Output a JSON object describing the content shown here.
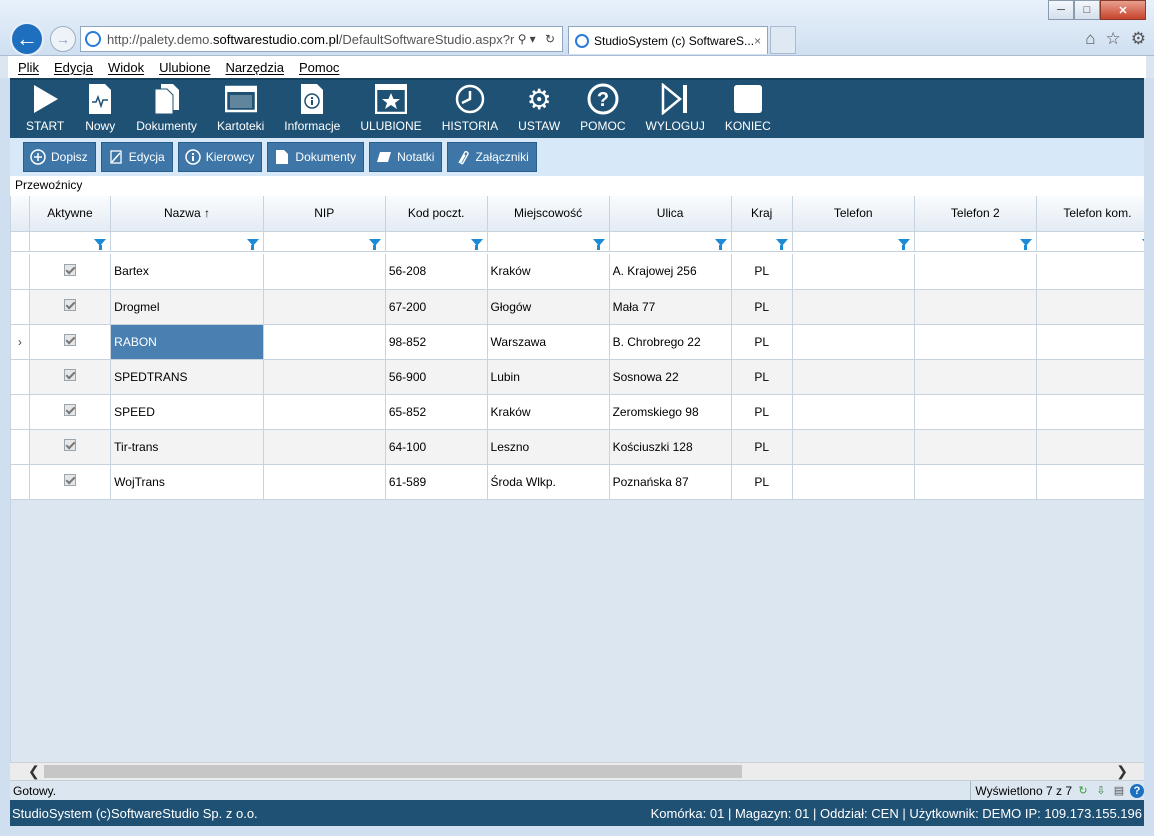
{
  "browser": {
    "url_prefix": "http://palety.demo.",
    "url_domain": "softwarestudio.com.pl",
    "url_path": "/DefaultSoftwareStudio.aspx?rol",
    "tab_title": "StudioSystem (c) SoftwareS...",
    "tab_close": "×"
  },
  "menu": [
    "Plik",
    "Edycja",
    "Widok",
    "Ulubione",
    "Narzędzia",
    "Pomoc"
  ],
  "toolbar": [
    {
      "label": "START",
      "icon": "play-icon"
    },
    {
      "label": "Nowy",
      "icon": "new-document-icon"
    },
    {
      "label": "Dokumenty",
      "icon": "documents-icon"
    },
    {
      "label": "Kartoteki",
      "icon": "window-icon"
    },
    {
      "label": "Informacje",
      "icon": "info-document-icon"
    },
    {
      "label": "ULUBIONE",
      "icon": "star-icon"
    },
    {
      "label": "HISTORIA",
      "icon": "history-icon"
    },
    {
      "label": "USTAW",
      "icon": "gears-icon"
    },
    {
      "label": "POMOC",
      "icon": "help-icon"
    },
    {
      "label": "WYLOGUJ",
      "icon": "logout-icon"
    },
    {
      "label": "KONIEC",
      "icon": "stop-icon"
    }
  ],
  "actions": [
    {
      "label": "Dopisz",
      "icon": "plus-circle-icon"
    },
    {
      "label": "Edycja",
      "icon": "edit-icon"
    },
    {
      "label": "Kierowcy",
      "icon": "info-circle-icon"
    },
    {
      "label": "Dokumenty",
      "icon": "document-icon"
    },
    {
      "label": "Notatki",
      "icon": "note-icon"
    },
    {
      "label": "Załączniki",
      "icon": "paperclip-icon"
    }
  ],
  "section_title": "Przewoźnicy",
  "columns": [
    "Aktywne",
    "Nazwa ↑",
    "NIP",
    "Kod poczt.",
    "Miejscowość",
    "Ulica",
    "Kraj",
    "Telefon",
    "Telefon 2",
    "Telefon kom."
  ],
  "rows": [
    {
      "active": true,
      "name": "Bartex",
      "nip": "",
      "zip": "56-208",
      "city": "Kraków",
      "street": "A. Krajowej 256",
      "country": "PL",
      "phone": "",
      "phone2": "",
      "mobile": ""
    },
    {
      "active": true,
      "name": "Drogmel",
      "nip": "",
      "zip": "67-200",
      "city": "Głogów",
      "street": "Mała 77",
      "country": "PL",
      "phone": "",
      "phone2": "",
      "mobile": ""
    },
    {
      "active": true,
      "name": "RABON",
      "nip": "",
      "zip": "98-852",
      "city": "Warszawa",
      "street": "B. Chrobrego 22",
      "country": "PL",
      "phone": "",
      "phone2": "",
      "mobile": "",
      "selected": true
    },
    {
      "active": true,
      "name": "SPEDTRANS",
      "nip": "",
      "zip": "56-900",
      "city": "Lubin",
      "street": "Sosnowa 22",
      "country": "PL",
      "phone": "",
      "phone2": "",
      "mobile": ""
    },
    {
      "active": true,
      "name": "SPEED",
      "nip": "",
      "zip": "65-852",
      "city": "Kraków",
      "street": "Zeromskiego 98",
      "country": "PL",
      "phone": "",
      "phone2": "",
      "mobile": ""
    },
    {
      "active": true,
      "name": "Tir-trans",
      "nip": "",
      "zip": "64-100",
      "city": "Leszno",
      "street": "Kościuszki 128",
      "country": "PL",
      "phone": "",
      "phone2": "",
      "mobile": ""
    },
    {
      "active": true,
      "name": "WojTrans",
      "nip": "",
      "zip": "61-589",
      "city": "Środa Wlkp.",
      "street": "Poznańska 87",
      "country": "PL",
      "phone": "",
      "phone2": "",
      "mobile": ""
    }
  ],
  "status": {
    "text": "Gotowy.",
    "count": "Wyświetlono 7 z 7"
  },
  "footer": {
    "left": "StudioSystem (c)SoftwareStudio Sp. z o.o.",
    "right": "Komórka: 01 | Magazyn: 01 | Oddział: CEN | Użytkownik: DEMO IP: 109.173.155.196"
  },
  "colors": {
    "toolbar_bg": "#1f5174",
    "action_btn": "#3d76a7",
    "selection": "#4a7fb2",
    "filter_icon": "#1d8ad6"
  }
}
